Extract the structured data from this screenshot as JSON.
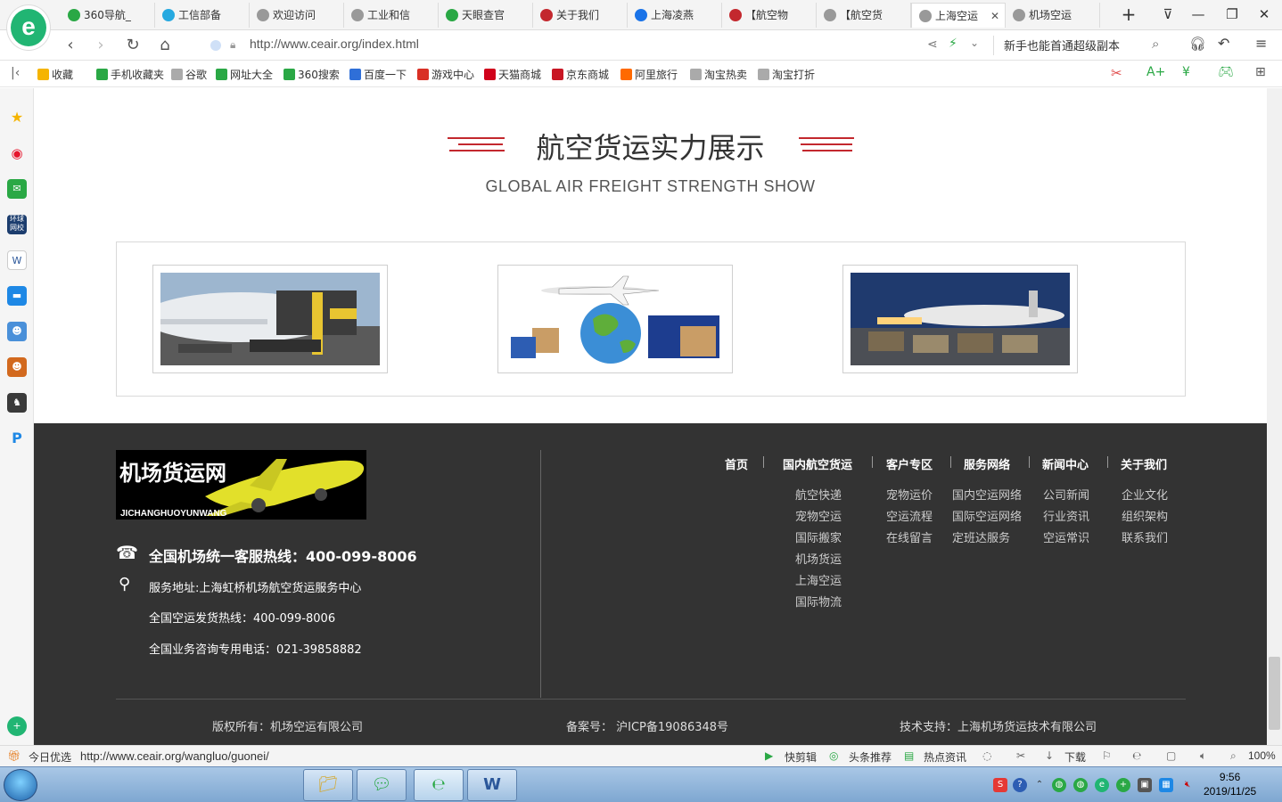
{
  "browser": {
    "tabs": [
      {
        "label": "360导航_",
        "icon_color": "#2aa845"
      },
      {
        "label": "工信部备",
        "icon_color": "#26a9e0"
      },
      {
        "label": "欢迎访问",
        "icon_color": "#999999"
      },
      {
        "label": "工业和信",
        "icon_color": "#999999"
      },
      {
        "label": "天眼查官",
        "icon_color": "#2aa845"
      },
      {
        "label": "关于我们",
        "icon_color": "#c3282e"
      },
      {
        "label": "上海凌燕",
        "icon_color": "#1a73e8"
      },
      {
        "label": "【航空物",
        "icon_color": "#c3282e"
      },
      {
        "label": "【航空货",
        "icon_color": "#999999"
      },
      {
        "label": "上海空运",
        "icon_color": "#999999"
      },
      {
        "label": "机场空运",
        "icon_color": "#999999"
      }
    ],
    "active_tab_index": 9,
    "new_tab": "+",
    "url": "http://www.ceair.org/index.html",
    "search_suggest": "新手也能首通超级副本",
    "bookmarks": [
      {
        "label": "收藏",
        "color": "#f5b400"
      },
      {
        "label": "手机收藏夹",
        "color": "#2aa845"
      },
      {
        "label": "谷歌",
        "color": "#aaaaaa"
      },
      {
        "label": "网址大全",
        "color": "#2aa845"
      },
      {
        "label": "360搜索",
        "color": "#2aa845"
      },
      {
        "label": "百度一下",
        "color": "#2f6fd8"
      },
      {
        "label": "游戏中心",
        "color": "#d93025"
      },
      {
        "label": "天猫商城",
        "color": "#d0021b"
      },
      {
        "label": "京东商城",
        "color": "#c81623"
      },
      {
        "label": "阿里旅行",
        "color": "#ff6a00"
      },
      {
        "label": "淘宝热卖",
        "color": "#aaaaaa"
      },
      {
        "label": "淘宝打折",
        "color": "#aaaaaa"
      }
    ]
  },
  "section": {
    "title_cn": "航空货运实力展示",
    "title_en": "GLOBAL AIR FREIGHT STRENGTH SHOW"
  },
  "footer": {
    "logo_cn": "机场货运网",
    "logo_en": "JICHANGHUOYUNWANG",
    "hotline": "全国机场统一客服热线：400-099-8006",
    "address": "服务地址:上海虹桥机场航空货运服务中心",
    "shipping_hotline": "全国空运发货热线：400-099-8006",
    "consult_phone": "全国业务咨询专用电话：021-39858882",
    "nav": [
      {
        "label": "首页",
        "items": []
      },
      {
        "label": "国内航空货运",
        "items": [
          "航空快递",
          "宠物空运",
          "国际搬家",
          "机场货运",
          "上海空运",
          "国际物流"
        ]
      },
      {
        "label": "客户专区",
        "items": [
          "宠物运价",
          "空运流程",
          "在线留言"
        ]
      },
      {
        "label": "服务网络",
        "items": [
          "国内空运网络",
          "国际空运网络",
          "定班达服务"
        ]
      },
      {
        "label": "新闻中心",
        "items": [
          "公司新闻",
          "行业资讯",
          "空运常识"
        ]
      },
      {
        "label": "关于我们",
        "items": [
          "企业文化",
          "组织架构",
          "联系我们"
        ]
      }
    ],
    "copyright": "版权所有：机场空运有限公司",
    "icp": "备案号： 沪ICP备19086348号",
    "tech": "技术支持：上海机场货运技术有限公司"
  },
  "statusbar": {
    "left_label": "今日优选",
    "hover_url": "http://www.ceair.org/wangluo/guonei/",
    "items": [
      "快剪辑",
      "头条推荐",
      "热点资讯",
      "下载"
    ],
    "zoom": "100%"
  },
  "taskbar": {
    "time": "9:56",
    "date": "2019/11/25"
  },
  "colors": {
    "accent": "#c3282e",
    "footer_bg": "#333333",
    "brand_green": "#21b573"
  }
}
